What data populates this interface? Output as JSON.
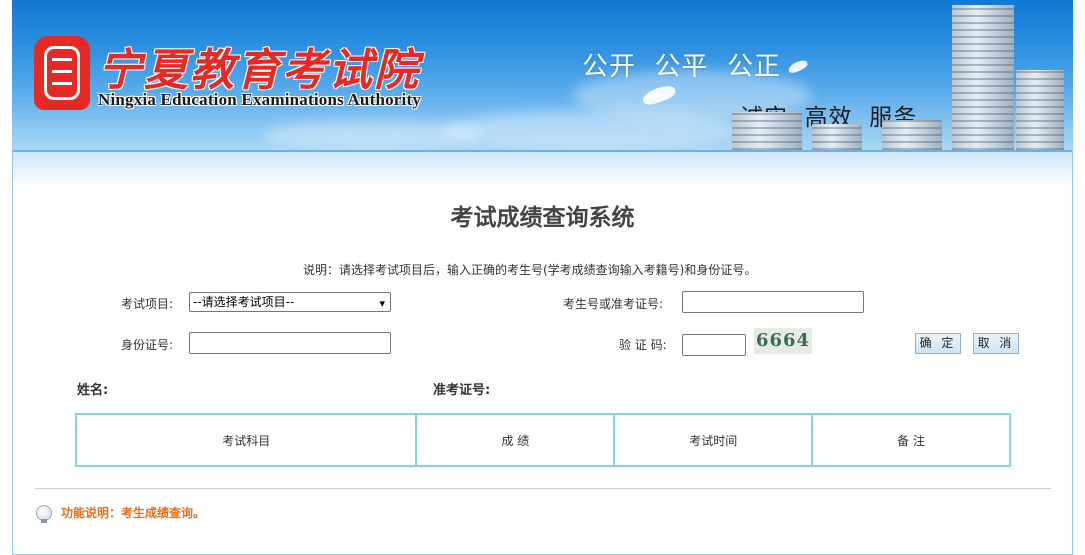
{
  "header": {
    "logo_cn": "宁夏教育考试院",
    "logo_en": "Ningxia Education Examinations Authority",
    "slogan_top": "公开  公平  公正",
    "slogan_bottom": "诚实  高效  服务"
  },
  "page": {
    "title": "考试成绩查询系统",
    "description": "说明：请选择考试项目后，输入正确的考生号(学考成绩查询输入考籍号)和身份证号。"
  },
  "form": {
    "exam_item_label": "考试项目:",
    "exam_item_selected": "--请选择考试项目--",
    "candidate_no_label": "考生号或准考证号:",
    "candidate_no_value": "",
    "id_label": "身份证号:",
    "id_value": "",
    "captcha_label": "验 证 码:",
    "captcha_value": "",
    "captcha_text": "6664",
    "confirm_label": "确 定",
    "cancel_label": "取 消"
  },
  "result": {
    "name_label": "姓名:",
    "ticket_label": "准考证号:",
    "columns": [
      "考试科目",
      "成 绩",
      "考试时间",
      "备 注"
    ]
  },
  "footer": {
    "function_note": "功能说明：考生成绩查询。"
  },
  "colors": {
    "banner_blue": "#1178d4",
    "seal_red": "#e52a26",
    "table_border": "#86d3dc",
    "note_orange": "#e5701b"
  }
}
